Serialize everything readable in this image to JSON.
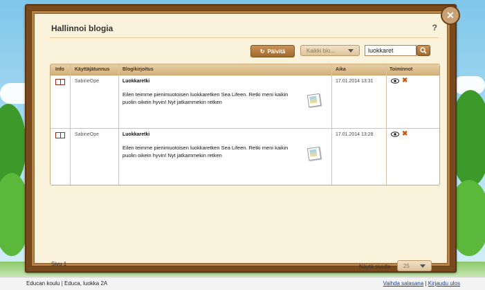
{
  "dialog": {
    "title": "Hallinnoi blogia",
    "help_label": "?"
  },
  "toolbar": {
    "refresh_label": "Päivitä",
    "blog_filter_value": "Kaikki blo...",
    "search_value": "luokkaret"
  },
  "table": {
    "headers": [
      "Info",
      "Käyttäjätunnus",
      "Blogikirjoitus",
      "Aika",
      "Toiminnot"
    ],
    "rows": [
      {
        "user": "SabineOpe",
        "title": "Luokkaretki",
        "text": "Eilen teimme pienimuotoisen luokkaretken Sea Lifeen. Retki meni kaikin puolin oikein hyvin! Nyt jatkammekin retken",
        "time": "17.01.2014 13:31"
      },
      {
        "user": "SabineOpe",
        "title": "Luokkaretki",
        "text": "Eilen teimme pienimuotoisen luokkaretken Sea Lifeen. Retki meni kaikin puolin oikein hyvin! Nyt jatkammekin retken",
        "time": "17.01.2014 13:28"
      }
    ]
  },
  "pagination": {
    "page_label": "Sivu 1",
    "show_label": "Näytä sivulla",
    "per_page_value": "25"
  },
  "footer": {
    "school": "Educan koulu | Educa, luokka 2A",
    "change_password": "Vaihda salasana",
    "separator": "|",
    "logout": "Kirjaudu ulos"
  },
  "colors": {
    "accent": "#a06a2f",
    "panel": "#fbf2dc",
    "frame": "#7a4a1f"
  }
}
